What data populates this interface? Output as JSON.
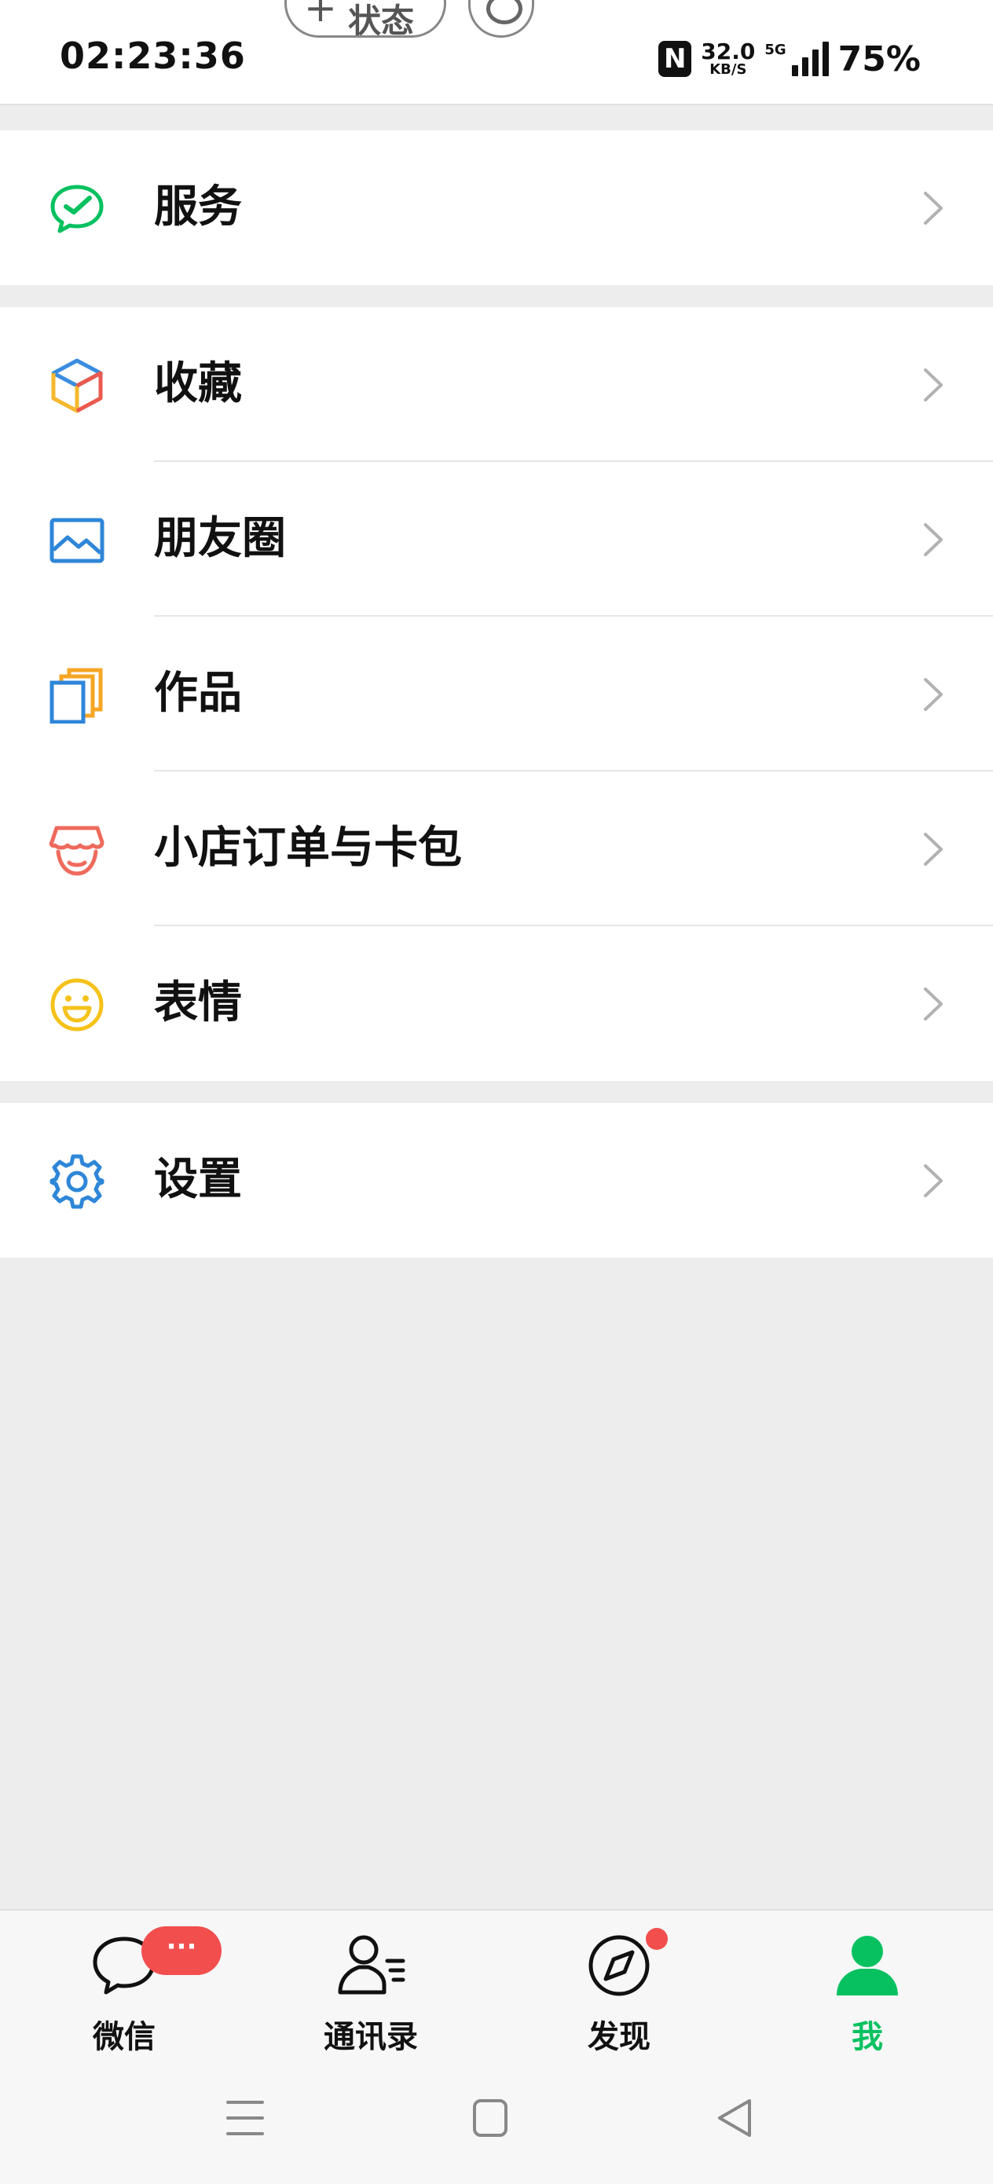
{
  "status_bar": {
    "time": "02:23:36",
    "pill_label": "状态",
    "nfc": "N",
    "net_speed_value": "32.0",
    "net_speed_unit": "KB/S",
    "network": "5G",
    "battery": "75%"
  },
  "menu": {
    "services": "服务",
    "favorites": "收藏",
    "moments": "朋友圈",
    "works": "作品",
    "shop_orders": "小店订单与卡包",
    "stickers": "表情",
    "settings": "设置"
  },
  "tabbar": {
    "chats": "微信",
    "chats_badge": "···",
    "contacts": "通讯录",
    "discover": "发现",
    "me": "我"
  },
  "colors": {
    "accent": "#07c160",
    "badge": "#f24e4e",
    "background": "#ededed"
  }
}
